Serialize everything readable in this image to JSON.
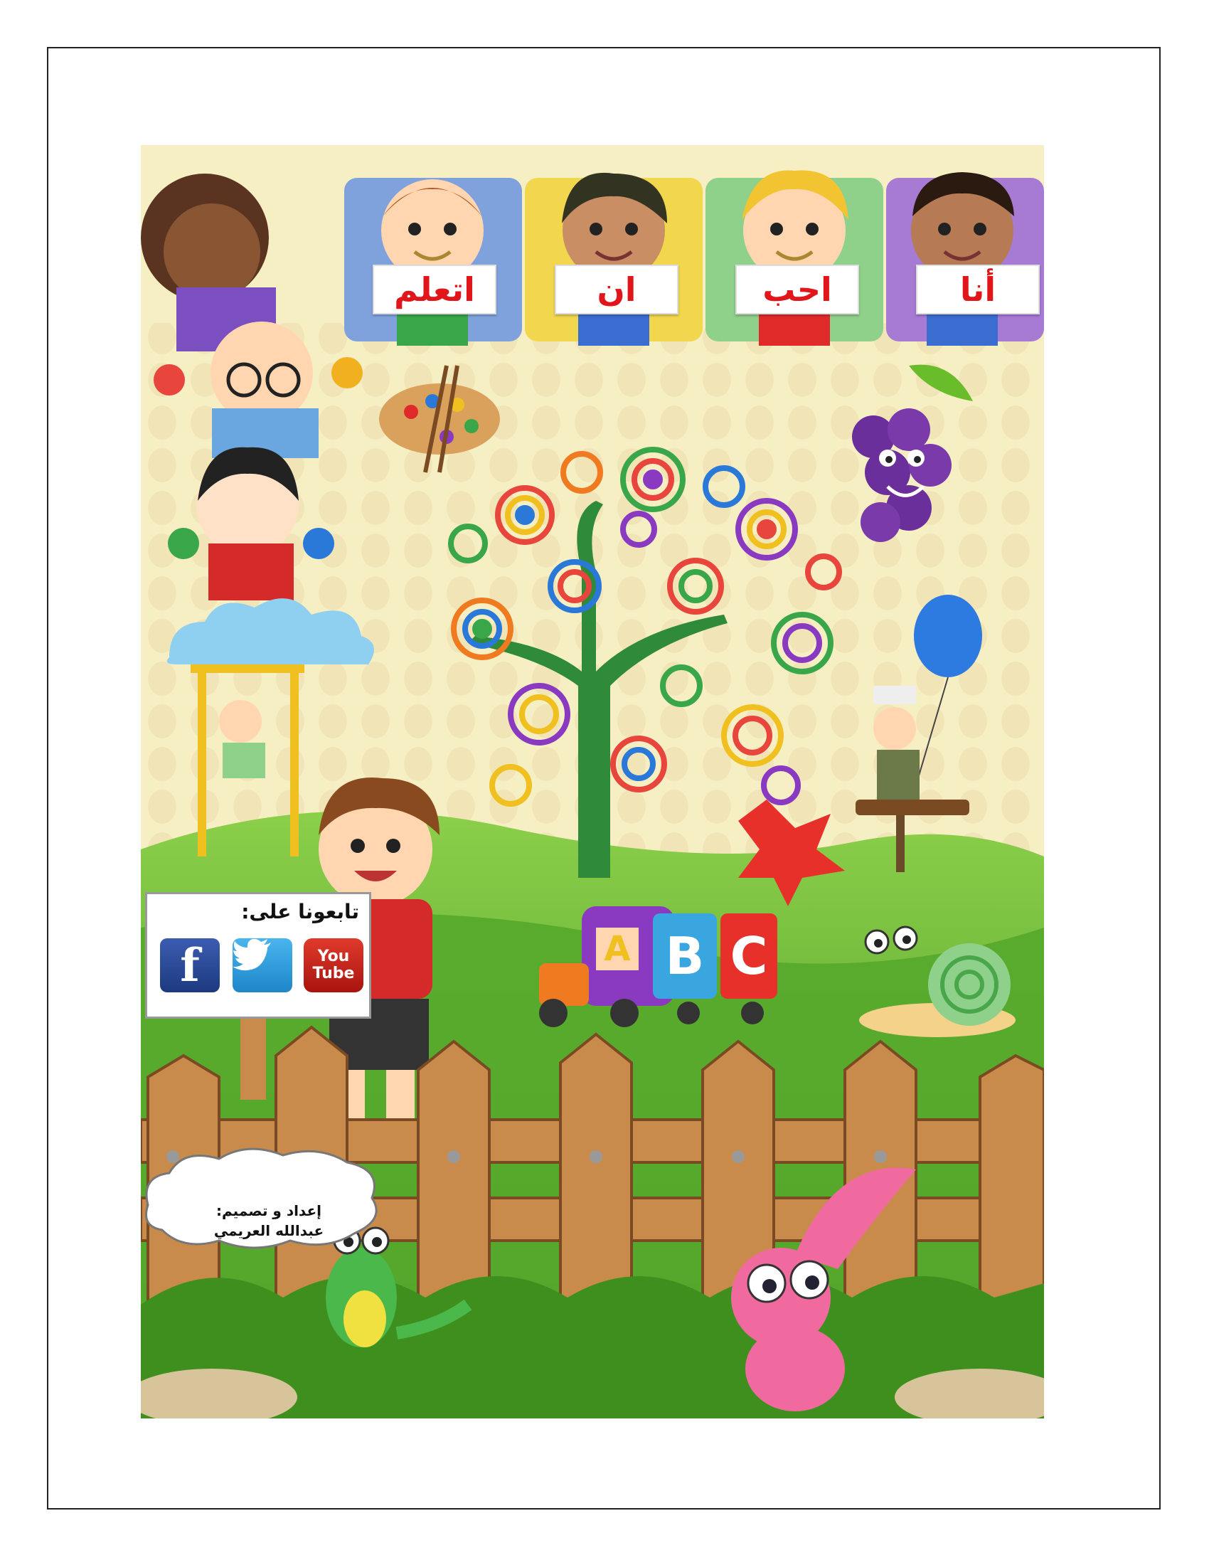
{
  "cover": {
    "title_words": [
      "أنا",
      "احب",
      "ان",
      "اتعلم"
    ],
    "follow_sign": {
      "title": "تابعونا على:",
      "networks": {
        "facebook": "f",
        "twitter_icon": "twitter-bird-icon",
        "youtube_line1": "You",
        "youtube_line2": "Tube"
      }
    },
    "credit": {
      "line1": "إعداد و تصميم:",
      "line2": "عبدالله العريمي"
    },
    "train_letters": [
      "A",
      "B",
      "C"
    ]
  },
  "colors": {
    "background": "#f7efc4",
    "grass": "#5fae2e",
    "fence": "#c98b4c",
    "word_text": "#e0161b",
    "sky_card_blue": "#7fa2dc",
    "card_yellow": "#f2d64e",
    "card_green": "#8fd08a",
    "card_purple": "#a77ad4"
  }
}
